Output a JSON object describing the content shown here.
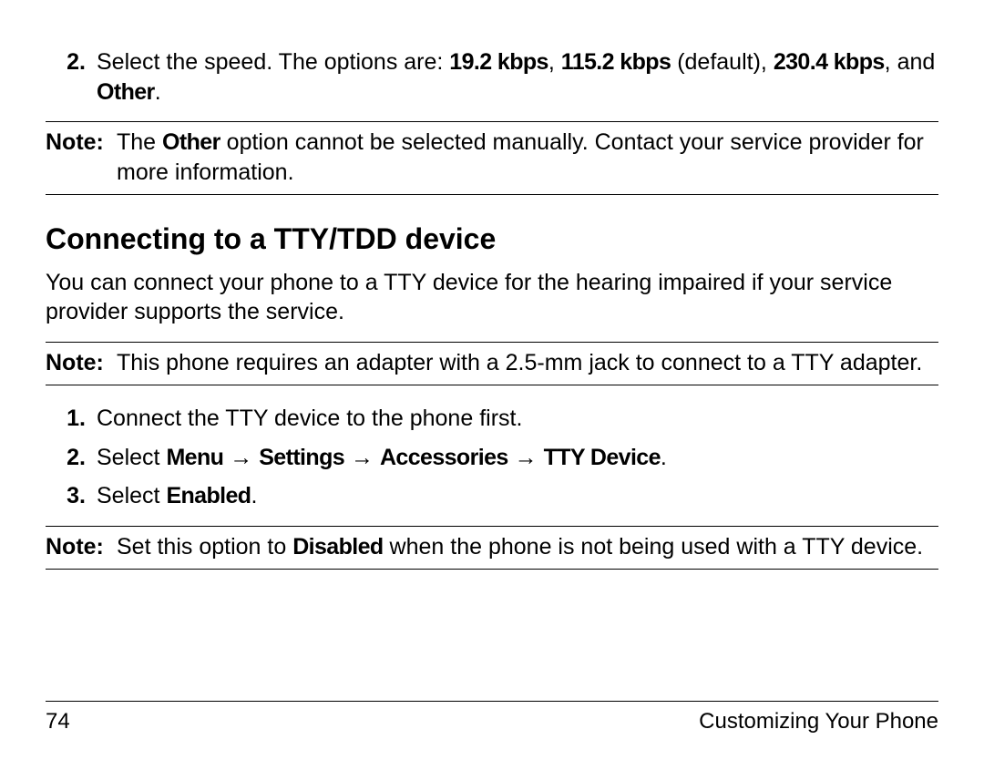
{
  "topStep": {
    "num": "2.",
    "text_a": "Select the speed. The options are: ",
    "opt1": "19.2 kbps",
    "sep1": ", ",
    "opt2": "115.2 kbps",
    "default": " (default), ",
    "opt3": "230.4 kbps",
    "sep2": ", and ",
    "opt4": "Other",
    "tail": "."
  },
  "note1": {
    "label": "Note:",
    "a": "The ",
    "b": "Other",
    "c": " option cannot be selected manually. Contact your service provider for more information."
  },
  "heading": "Connecting to a TTY/TDD device",
  "intro": "You can connect your phone to a TTY device for the hearing impaired if your service provider supports the service.",
  "note2": {
    "label": "Note:",
    "text": "This phone requires an adapter with a 2.5-mm jack to connect to a TTY adapter."
  },
  "steps": {
    "s1": {
      "num": "1.",
      "text": "Connect the TTY device to the phone first."
    },
    "s2": {
      "num": "2.",
      "a": "Select ",
      "m1": "Menu",
      "arr": " → ",
      "m2": "Settings",
      "m3": "Accessories",
      "m4": "TTY Device",
      "tail": "."
    },
    "s3": {
      "num": "3.",
      "a": "Select ",
      "b": "Enabled",
      "tail": "."
    }
  },
  "note3": {
    "label": "Note:",
    "a": "Set this option to ",
    "b": "Disabled",
    "c": " when the phone is not being used with a TTY device."
  },
  "footer": {
    "page": "74",
    "section": "Customizing Your Phone"
  }
}
